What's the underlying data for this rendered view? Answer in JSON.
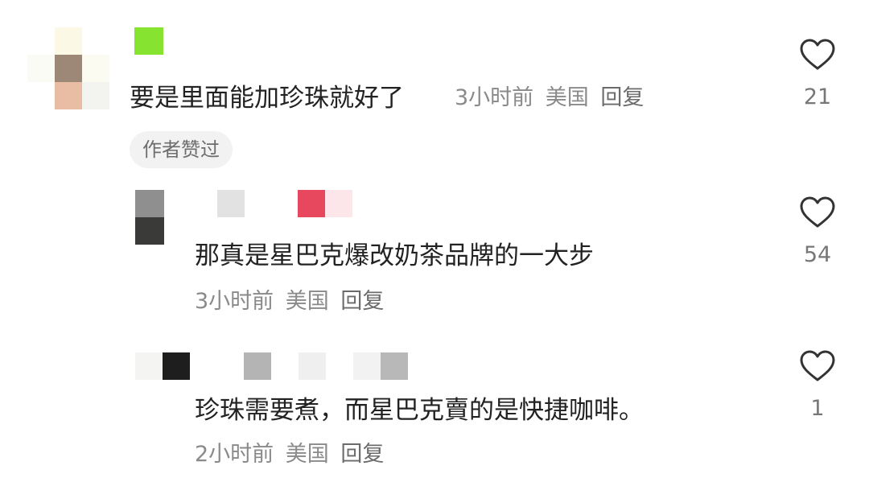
{
  "comments": [
    {
      "text": "要是里面能加珍珠就好了",
      "time": "3小时前",
      "location": "美国",
      "reply_label": "回复",
      "like_count": "21",
      "badge": "作者赞过"
    },
    {
      "text": "那真是星巴克爆改奶茶品牌的一大步",
      "time": "3小时前",
      "location": "美国",
      "reply_label": "回复",
      "like_count": "54"
    },
    {
      "text": "珍珠需要煮，而星巴克賣的是快捷咖啡。",
      "time": "2小时前",
      "location": "美国",
      "reply_label": "回复",
      "like_count": "1"
    }
  ],
  "icons": {
    "like": "heart-outline-icon"
  },
  "colors": {
    "text": "#222222",
    "meta": "#8a8a8a",
    "badge_bg": "#f2f2f2"
  }
}
